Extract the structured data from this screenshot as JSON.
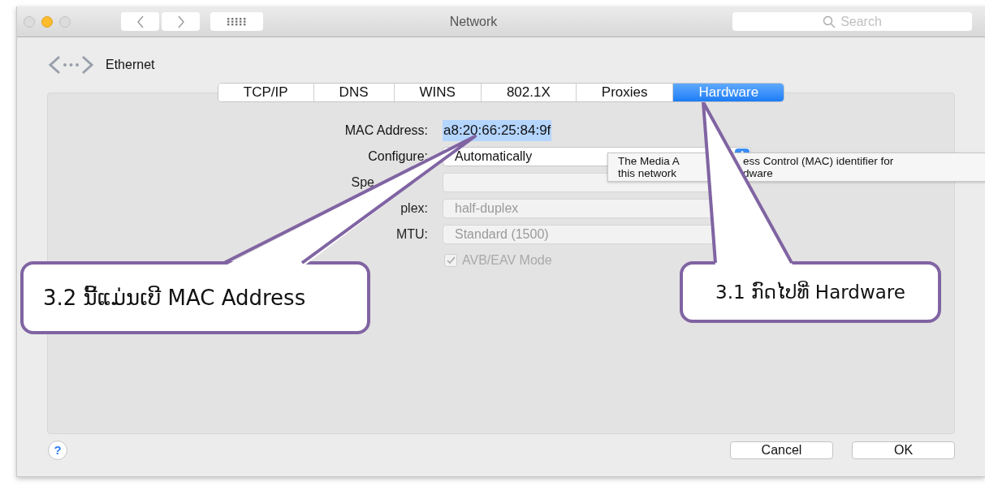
{
  "window": {
    "title": "Network",
    "search": {
      "placeholder": "Search"
    }
  },
  "interface": {
    "name": "Ethernet"
  },
  "tabs": [
    {
      "label": "TCP/IP",
      "selected": false
    },
    {
      "label": "DNS",
      "selected": false
    },
    {
      "label": "WINS",
      "selected": false
    },
    {
      "label": "802.1X",
      "selected": false
    },
    {
      "label": "Proxies",
      "selected": false
    },
    {
      "label": "Hardware",
      "selected": true
    }
  ],
  "form": [
    {
      "kind": "text",
      "label": "MAC Address:",
      "value": "a8:20:66:25:84:9f",
      "highlighted": true
    },
    {
      "kind": "select",
      "label": "Configure:",
      "value": "Automatically",
      "disabled": false
    },
    {
      "kind": "field",
      "label": "Spe",
      "disabled": true,
      "covered": true
    },
    {
      "kind": "field",
      "label": "plex:",
      "value": "half-duplex",
      "disabled": true
    },
    {
      "kind": "field",
      "label": "MTU:",
      "value": "Standard  (1500)",
      "disabled": true
    },
    {
      "kind": "checkbox",
      "label": "AVB/EAV Mode",
      "checked": true,
      "disabled": true
    }
  ],
  "tooltip": {
    "lines": [
      [
        "The Media A",
        "ess Control (MAC) identifier for"
      ],
      [
        "this network",
        "dware"
      ]
    ]
  },
  "help_button": {
    "label": "?"
  },
  "buttons": [
    {
      "label": "Cancel"
    },
    {
      "label": "OK"
    }
  ],
  "callouts": [
    {
      "text": "3.2 ນີ້ແມ່ນເບີ MAC Address"
    },
    {
      "text": "3.1 ກົດໄປທີ່ Hardware"
    }
  ]
}
